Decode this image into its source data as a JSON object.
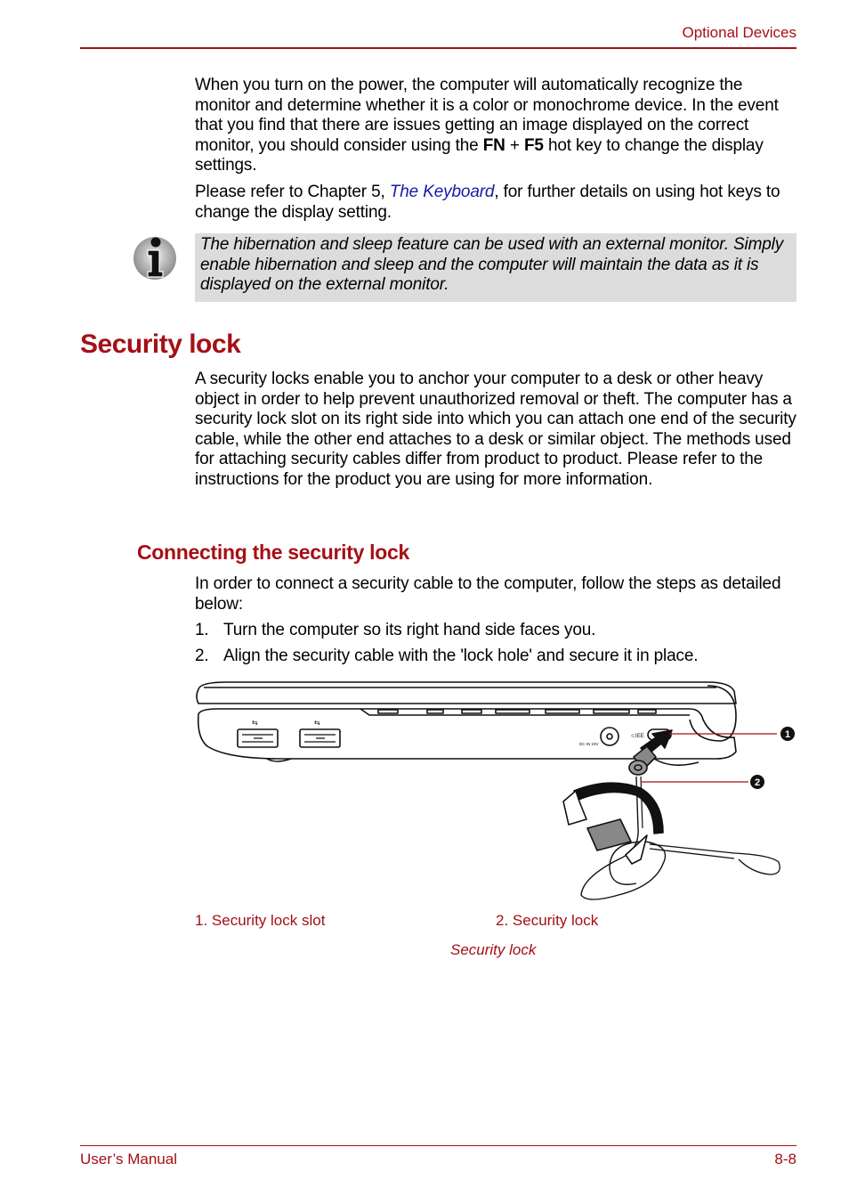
{
  "header": {
    "section": "Optional Devices"
  },
  "intro": {
    "para1_prefix": "When you turn on the power, the computer will automatically recognize the monitor and determine whether it is a color or monochrome device. In the event that you find that there are issues getting an image displayed on the correct monitor, you should consider using the ",
    "key1": "FN",
    "plus": " + ",
    "key2": "F5",
    "para1_suffix": " hot key to change the display settings.",
    "para2_prefix": "Please refer to Chapter 5, ",
    "para2_link": "The Keyboard",
    "para2_suffix": ", for further details on using hot keys to change the display setting."
  },
  "note": {
    "icon": "info-icon",
    "text": "The hibernation and sleep feature can be used with an external monitor. Simply enable hibernation and sleep and the computer will maintain the data as it is displayed on the external monitor."
  },
  "section": {
    "title": "Security lock",
    "body": "A security locks enable you to anchor your computer to a desk or other heavy object in order to help prevent unauthorized removal or theft. The computer has a security lock slot on its right side into which you can attach one end of the security cable, while the other end attaches to a desk or similar object. The methods used for attaching security cables differ from product to product. Please refer to the instructions for the product you are using for more information."
  },
  "subsection": {
    "title": "Connecting the security lock",
    "intro": "In order to connect a security cable to the computer, follow the steps as detailed below:",
    "steps": [
      {
        "num": "1.",
        "text": "Turn the computer so its right hand side faces you."
      },
      {
        "num": "2.",
        "text": "Align the security cable with the 'lock hole' and secure it in place."
      }
    ]
  },
  "figure": {
    "callouts": [
      "1",
      "2"
    ],
    "captions": [
      "1. Security lock slot",
      "2. Security lock"
    ],
    "title": "Security lock",
    "port_label": "DC IN 19V"
  },
  "footer": {
    "left": "User’s Manual",
    "right": "8-8"
  },
  "colors": {
    "accent": "#a50f15",
    "link": "#1a1aa6",
    "note_bg": "#dcdcdc"
  }
}
